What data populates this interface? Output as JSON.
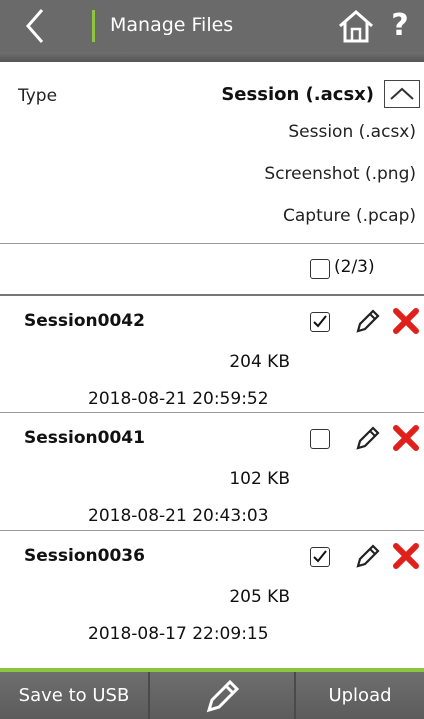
{
  "header": {
    "title": "Manage Files",
    "help": "?",
    "accent": "#8cc63f"
  },
  "filter": {
    "label": "Type",
    "selected": "Session (.acsx)",
    "options": [
      "Session (.acsx)",
      "Screenshot (.png)",
      "Capture (.pcap)"
    ]
  },
  "selection": {
    "count": "(2/3)",
    "all_checked": false
  },
  "files": [
    {
      "name": "Session0042",
      "size": "204 KB",
      "date": "2018-08-21 20:59:52",
      "checked": true
    },
    {
      "name": "Session0041",
      "size": "102 KB",
      "date": "2018-08-21 20:43:03",
      "checked": false
    },
    {
      "name": "Session0036",
      "size": "205 KB",
      "date": "2018-08-17 22:09:15",
      "checked": true
    }
  ],
  "footer": {
    "save": "Save to USB",
    "edit_icon": "pencil-icon",
    "upload": "Upload"
  },
  "colors": {
    "delete": "#e0201b",
    "bar": "#6a6a6a"
  }
}
